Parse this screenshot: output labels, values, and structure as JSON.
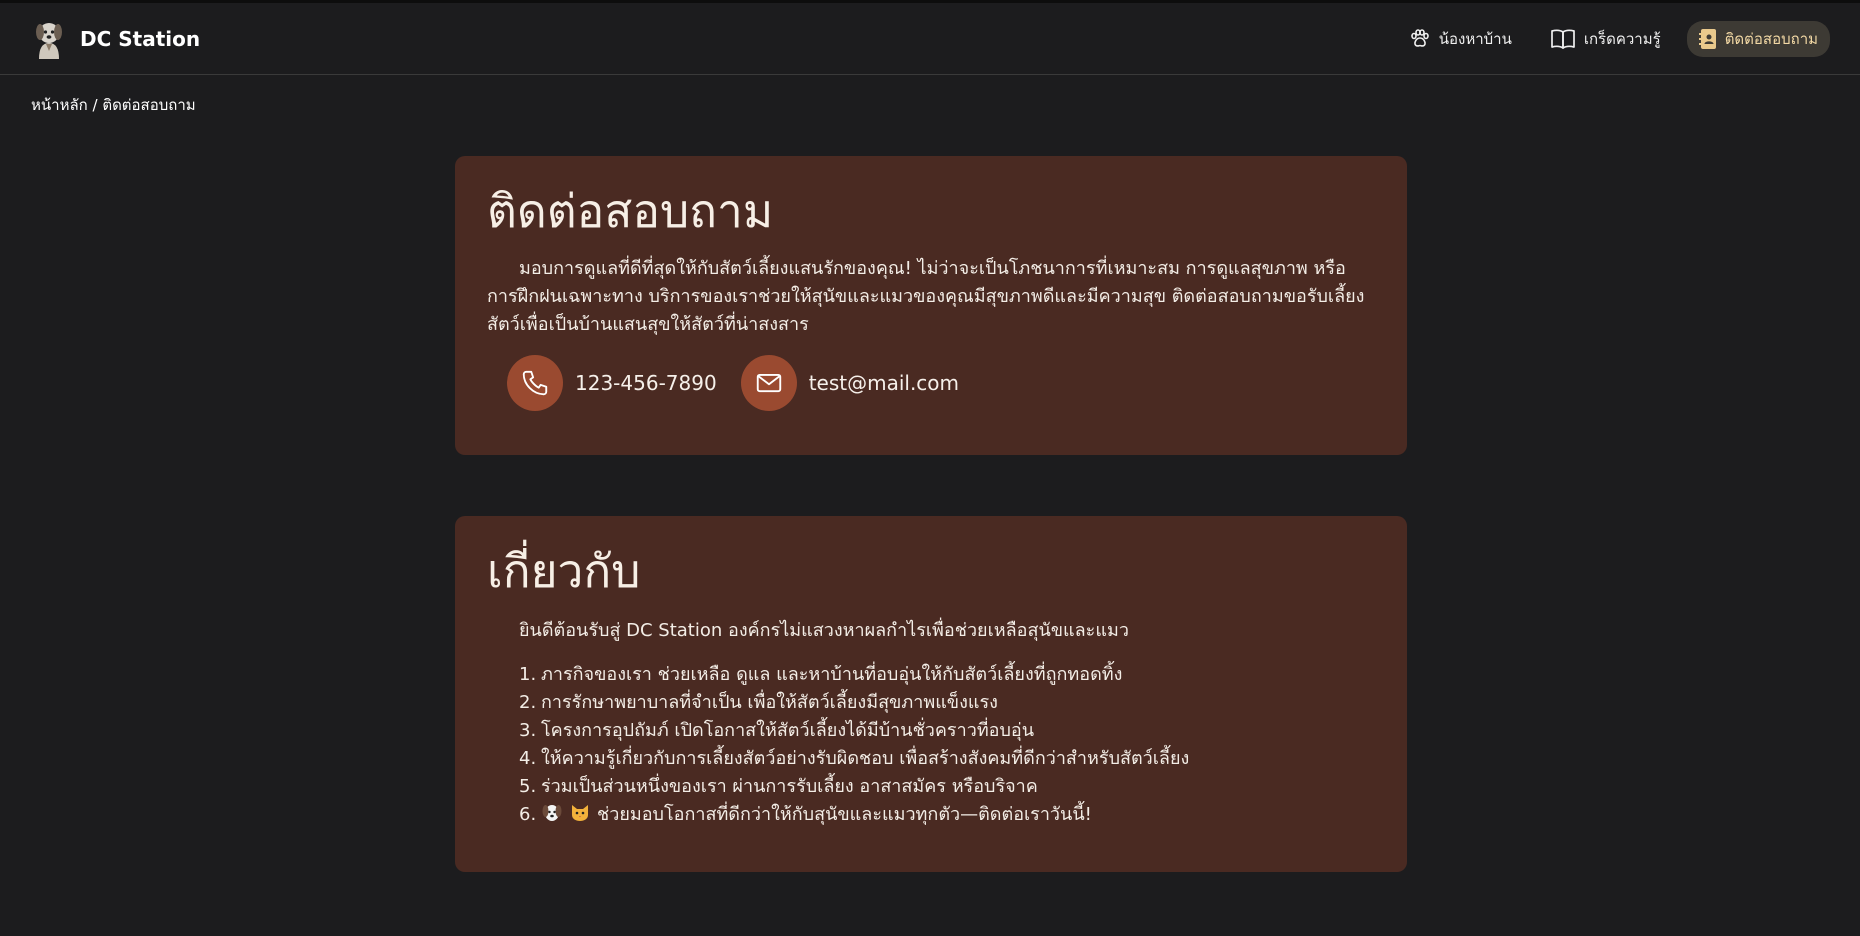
{
  "brand": {
    "name": "DC Station"
  },
  "nav": {
    "items": [
      {
        "label": "น้องหาบ้าน",
        "icon": "paw-icon",
        "active": false
      },
      {
        "label": "เกร็ดความรู้",
        "icon": "book-icon",
        "active": false
      },
      {
        "label": "ติดต่อสอบถาม",
        "icon": "contact-book-icon",
        "active": true
      }
    ]
  },
  "breadcrumb": {
    "home": "หน้าหลัก",
    "separator": " / ",
    "current": "ติดต่อสอบถาม"
  },
  "contact": {
    "title": "ติดต่อสอบถาม",
    "description": "มอบการดูแลที่ดีที่สุดให้กับสัตว์เลี้ยงแสนรักของคุณ! ไม่ว่าจะเป็นโภชนาการที่เหมาะสม การดูแลสุขภาพ หรือการฝึกฝนเฉพาะทาง บริการของเราช่วยให้สุนัขและแมวของคุณมีสุขภาพดีและมีความสุข ติดต่อสอบถามขอรับเลี้ยงสัตว์เพื่อเป็นบ้านแสนสุขให้สัตว์ที่น่าสงสาร",
    "phone": "123-456-7890",
    "email": "test@mail.com"
  },
  "about": {
    "title": "เกี่ยวกับ",
    "intro": "ยินดีต้อนรับสู่ DC Station องค์กรไม่แสวงหาผลกำไรเพื่อช่วยเหลือสุนัขและแมว",
    "items": [
      {
        "num": "1.",
        "text": "ภารกิจของเรา ช่วยเหลือ ดูแล และหาบ้านที่อบอุ่นให้กับสัตว์เลี้ยงที่ถูกทอดทิ้ง"
      },
      {
        "num": "2.",
        "text": "การรักษาพยาบาลที่จำเป็น เพื่อให้สัตว์เลี้ยงมีสุขภาพแข็งแรง"
      },
      {
        "num": "3.",
        "text": "โครงการอุปถัมภ์ เปิดโอกาสให้สัตว์เลี้ยงได้มีบ้านชั่วคราวที่อบอุ่น"
      },
      {
        "num": "4.",
        "text": "ให้ความรู้เกี่ยวกับการเลี้ยงสัตว์อย่างรับผิดชอบ เพื่อสร้างสังคมที่ดีกว่าสำหรับสัตว์เลี้ยง"
      },
      {
        "num": "5.",
        "text": "ร่วมเป็นส่วนหนึ่งของเรา ผ่านการรับเลี้ยง อาสาสมัคร หรือบริจาค"
      },
      {
        "num": "6.",
        "text": "ช่วยมอบโอกาสที่ดีกว่าให้กับสุนัขและแมวทุกตัว—ติดต่อเราวันนี้!"
      }
    ]
  },
  "colors": {
    "background": "#1c1c1e",
    "card": "#4a2a22",
    "accent_circle": "#9a4a30",
    "active_nav_bg": "#3d3a34",
    "active_nav_text": "#f3d9a5"
  }
}
